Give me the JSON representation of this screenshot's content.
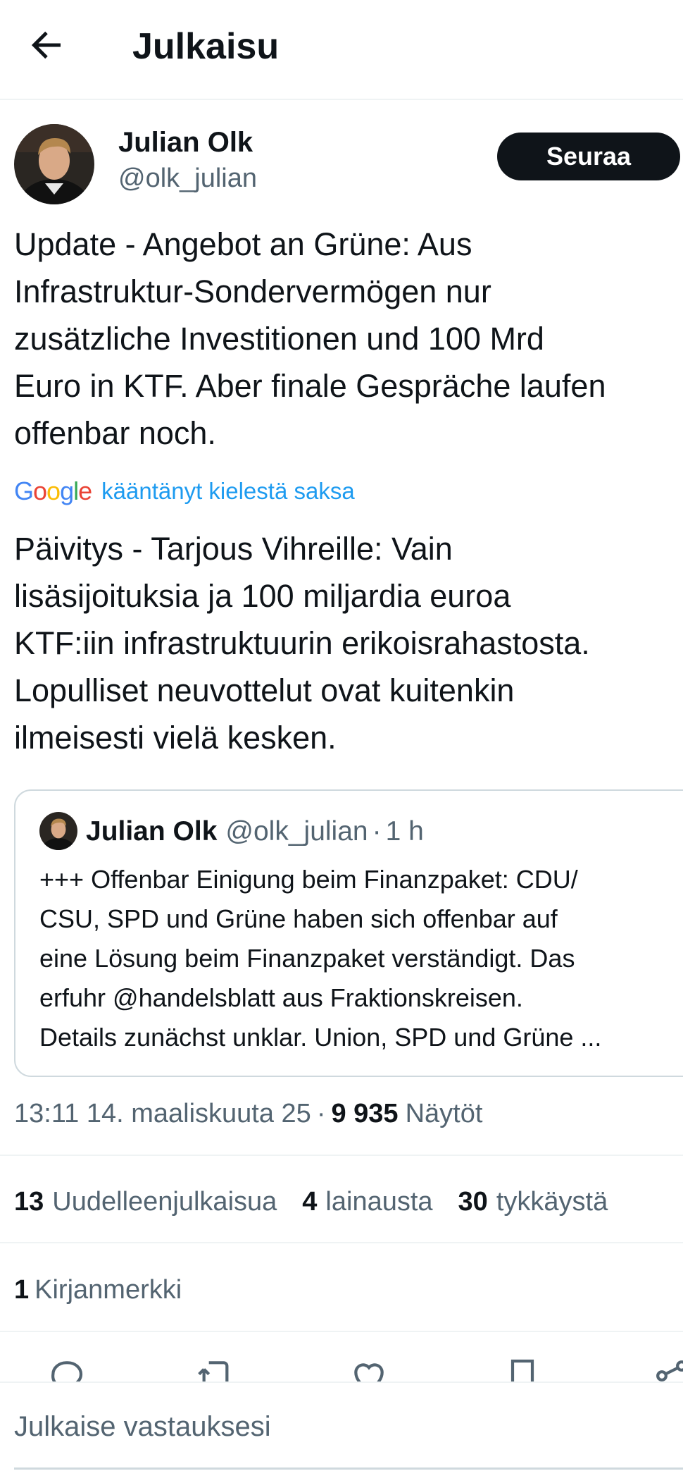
{
  "header": {
    "title": "Julkaisu"
  },
  "post": {
    "author_name": "Julian Olk",
    "author_handle": "@olk_julian",
    "follow_label": "Seuraa",
    "original_text": "Update - Angebot an Grüne: Aus\nInfrastruktur-Sondervermögen nur\nzusätzliche Investitionen und 100 Mrd\nEuro in KTF. Aber finale Gespräche laufen\noffenbar noch.",
    "translation_logo": "Google",
    "translation_label": "kääntänyt kielestä saksa",
    "translated_text": "Päivitys - Tarjous Vihreille: Vain\nlisäsijoituksia ja 100 miljardia euroa\nKTF:iin infrastruktuurin erikoisrahastosta.\nLopulliset neuvottelut ovat kuitenkin\nilmeisesti vielä kesken."
  },
  "quote": {
    "author_name": "Julian Olk",
    "author_handle": "@olk_julian",
    "separator": "·",
    "time": "1 h",
    "text": "+++ Offenbar Einigung beim Finanzpaket: CDU/\nCSU, SPD und Grüne haben sich offenbar auf\neine Lösung beim Finanzpaket verständigt. Das\nerfuhr @handelsblatt aus Fraktionskreisen.\nDetails zunächst unklar. Union, SPD und Grüne ..."
  },
  "meta": {
    "timestamp": "13:11 14. maaliskuuta 25",
    "separator": "·",
    "views_count": "9 935",
    "views_label": "Näytöt"
  },
  "stats": [
    {
      "count": "13",
      "label": "Uudelleenjulkaisua"
    },
    {
      "count": "4",
      "label": "lainausta"
    },
    {
      "count": "30",
      "label": "tykkäystä"
    }
  ],
  "bookmarks": {
    "count": "1",
    "label": "Kirjanmerkki"
  },
  "actions": {
    "icons": [
      "reply-icon",
      "repost-icon",
      "like-icon",
      "bookmark-icon",
      "share-icon"
    ]
  },
  "reply": {
    "placeholder": "Julkaise vastauksesi"
  },
  "colors": {
    "text": "#0f1419",
    "secondary": "#536471",
    "link": "#1d9bf0",
    "divider": "#eff3f4",
    "button_bg": "#0f1419"
  }
}
